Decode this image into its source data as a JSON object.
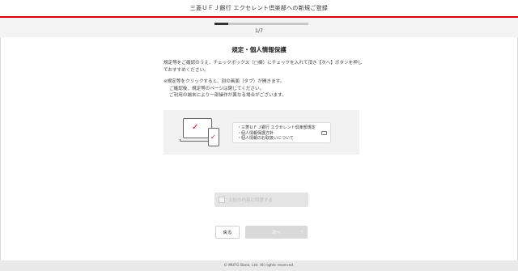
{
  "header": {
    "title": "三菱ＵＦＪ銀行 エクセレント倶楽部への新規ご登録"
  },
  "progress": {
    "label": "1/7",
    "current": 1,
    "total": 7
  },
  "section": {
    "title": "規定・個人情報保護"
  },
  "instructions": {
    "p1": "規定等をご確認のうえ、チェックボックス（□欄）にチェックを入れて頂き【次へ】ボタンを押しておすすめください。",
    "p2_line1": "※規定等をクリックすると、別の画面（タブ）が開きます。",
    "p2_line2": "ご確認後、規定等のページは閉じてください。",
    "p2_line3": "ご利用の端末により一部操作が異なる場合がございます。"
  },
  "documents": {
    "items": [
      "・三菱ＵＦＪ銀行 エクセレント倶楽部規定",
      "・個人情報保護方針",
      "・個人情報のお取扱いについて"
    ],
    "icon": "speech-bubble-icon"
  },
  "agreement": {
    "label": "上記の内容に同意する",
    "checked": false
  },
  "buttons": {
    "back": "戻る",
    "next": "次へ",
    "next_icon": "chevron-right-icon"
  },
  "footer": {
    "copyright": "© MUFG Bank, Ltd. All rights reserved."
  },
  "colors": {
    "accent": "#d6000f",
    "disabled": "#d9d9d9"
  }
}
